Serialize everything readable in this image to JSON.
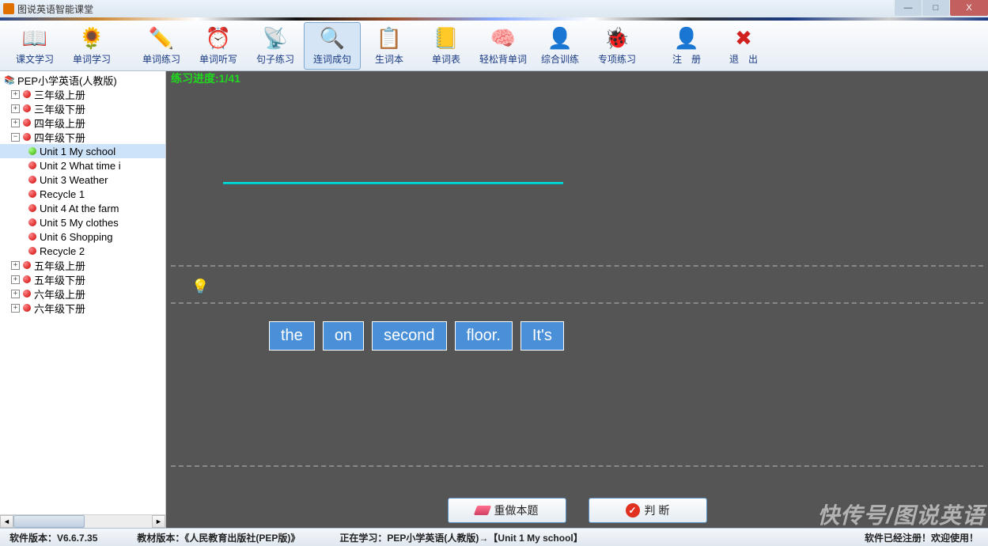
{
  "window": {
    "title": "图说英语智能课堂"
  },
  "toolbar": [
    {
      "id": "text-study",
      "label": "课文学习",
      "icon": "📖",
      "color": "#e05090"
    },
    {
      "id": "word-study",
      "label": "单词学习",
      "icon": "🌻",
      "color": "#f0c020"
    },
    {
      "id": "word-practice",
      "label": "单词练习",
      "icon": "✏️",
      "color": "#2060c0"
    },
    {
      "id": "word-dictation",
      "label": "单词听写",
      "icon": "⏰",
      "color": "#f08030"
    },
    {
      "id": "sentence-practice",
      "label": "句子练习",
      "icon": "📡",
      "color": "#8040c0"
    },
    {
      "id": "word-to-sentence",
      "label": "连词成句",
      "icon": "🔍",
      "color": "#e03030",
      "active": true
    },
    {
      "id": "new-words",
      "label": "生词本",
      "icon": "📋",
      "color": "#40a0e0"
    },
    {
      "id": "word-list",
      "label": "单词表",
      "icon": "📒",
      "color": "#4080e0"
    },
    {
      "id": "easy-recite",
      "label": "轻松背单词",
      "icon": "🧠",
      "color": "#e0a060"
    },
    {
      "id": "comprehensive",
      "label": "综合训练",
      "icon": "👤",
      "color": "#70c040"
    },
    {
      "id": "special",
      "label": "专项练习",
      "icon": "🐞",
      "color": "#f0c020"
    },
    {
      "id": "register",
      "label": "注　册",
      "icon": "👤",
      "color": "#4080e0"
    },
    {
      "id": "exit",
      "label": "退　出",
      "icon": "✖",
      "color": "#d02020"
    }
  ],
  "tree": {
    "root": "PEP小学英语(人教版)",
    "books": [
      {
        "label": "三年级上册",
        "expanded": false
      },
      {
        "label": "三年级下册",
        "expanded": false
      },
      {
        "label": "四年级上册",
        "expanded": false
      },
      {
        "label": "四年级下册",
        "expanded": true,
        "units": [
          {
            "label": "Unit 1 My school",
            "active": true
          },
          {
            "label": "Unit 2 What time i"
          },
          {
            "label": "Unit 3 Weather"
          },
          {
            "label": "Recycle 1"
          },
          {
            "label": "Unit 4 At the farm"
          },
          {
            "label": "Unit 5 My clothes"
          },
          {
            "label": "Unit 6 Shopping"
          },
          {
            "label": "Recycle 2"
          }
        ]
      },
      {
        "label": "五年级上册",
        "expanded": false
      },
      {
        "label": "五年级下册",
        "expanded": false
      },
      {
        "label": "六年级上册",
        "expanded": false
      },
      {
        "label": "六年级下册",
        "expanded": false
      }
    ]
  },
  "exercise": {
    "progress_label": "练习进度:1/41",
    "words": [
      "the",
      "on",
      "second",
      "floor.",
      "It's"
    ],
    "redo_label": "重做本题",
    "judge_label": "判 断"
  },
  "status": {
    "version_label": "软件版本：V6.6.7.35",
    "textbook_label": "教材版本：《人民教育出版社(PEP版)》",
    "studying_label": "正在学习：PEP小学英语(人教版)→【Unit 1 My school】",
    "register_label": "软件已经注册！欢迎使用！"
  },
  "watermark": "快传号/图说英语"
}
